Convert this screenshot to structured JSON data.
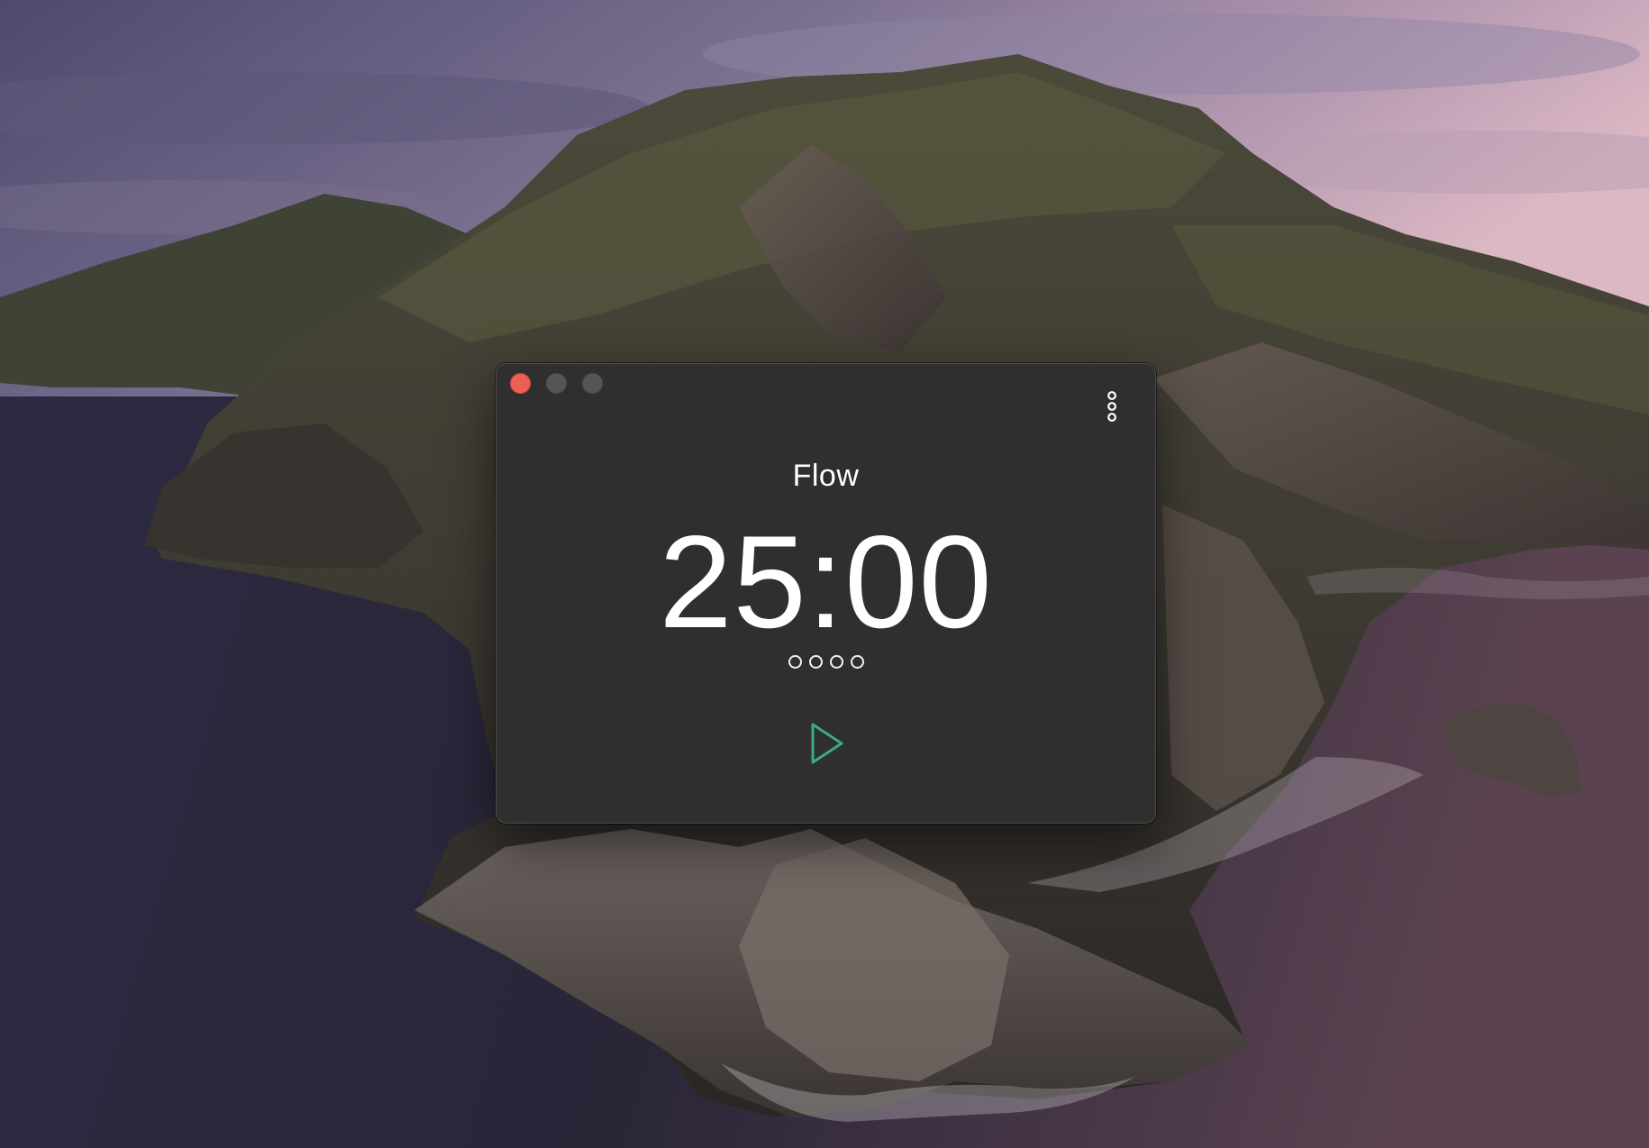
{
  "app": {
    "session_title": "Flow",
    "timer": "25:00",
    "session_count": 4,
    "completed_sessions": 0
  },
  "icons": {
    "close": "close-icon",
    "minimize": "minimize-icon",
    "zoom": "zoom-icon",
    "more": "more-vertical-icon",
    "play": "play-icon"
  },
  "colors": {
    "window_background": "#2f2f2f",
    "close_light": "#ec5f55",
    "inactive_light": "#555555",
    "text": "#ffffff",
    "play_accent": "#3daa7e"
  }
}
